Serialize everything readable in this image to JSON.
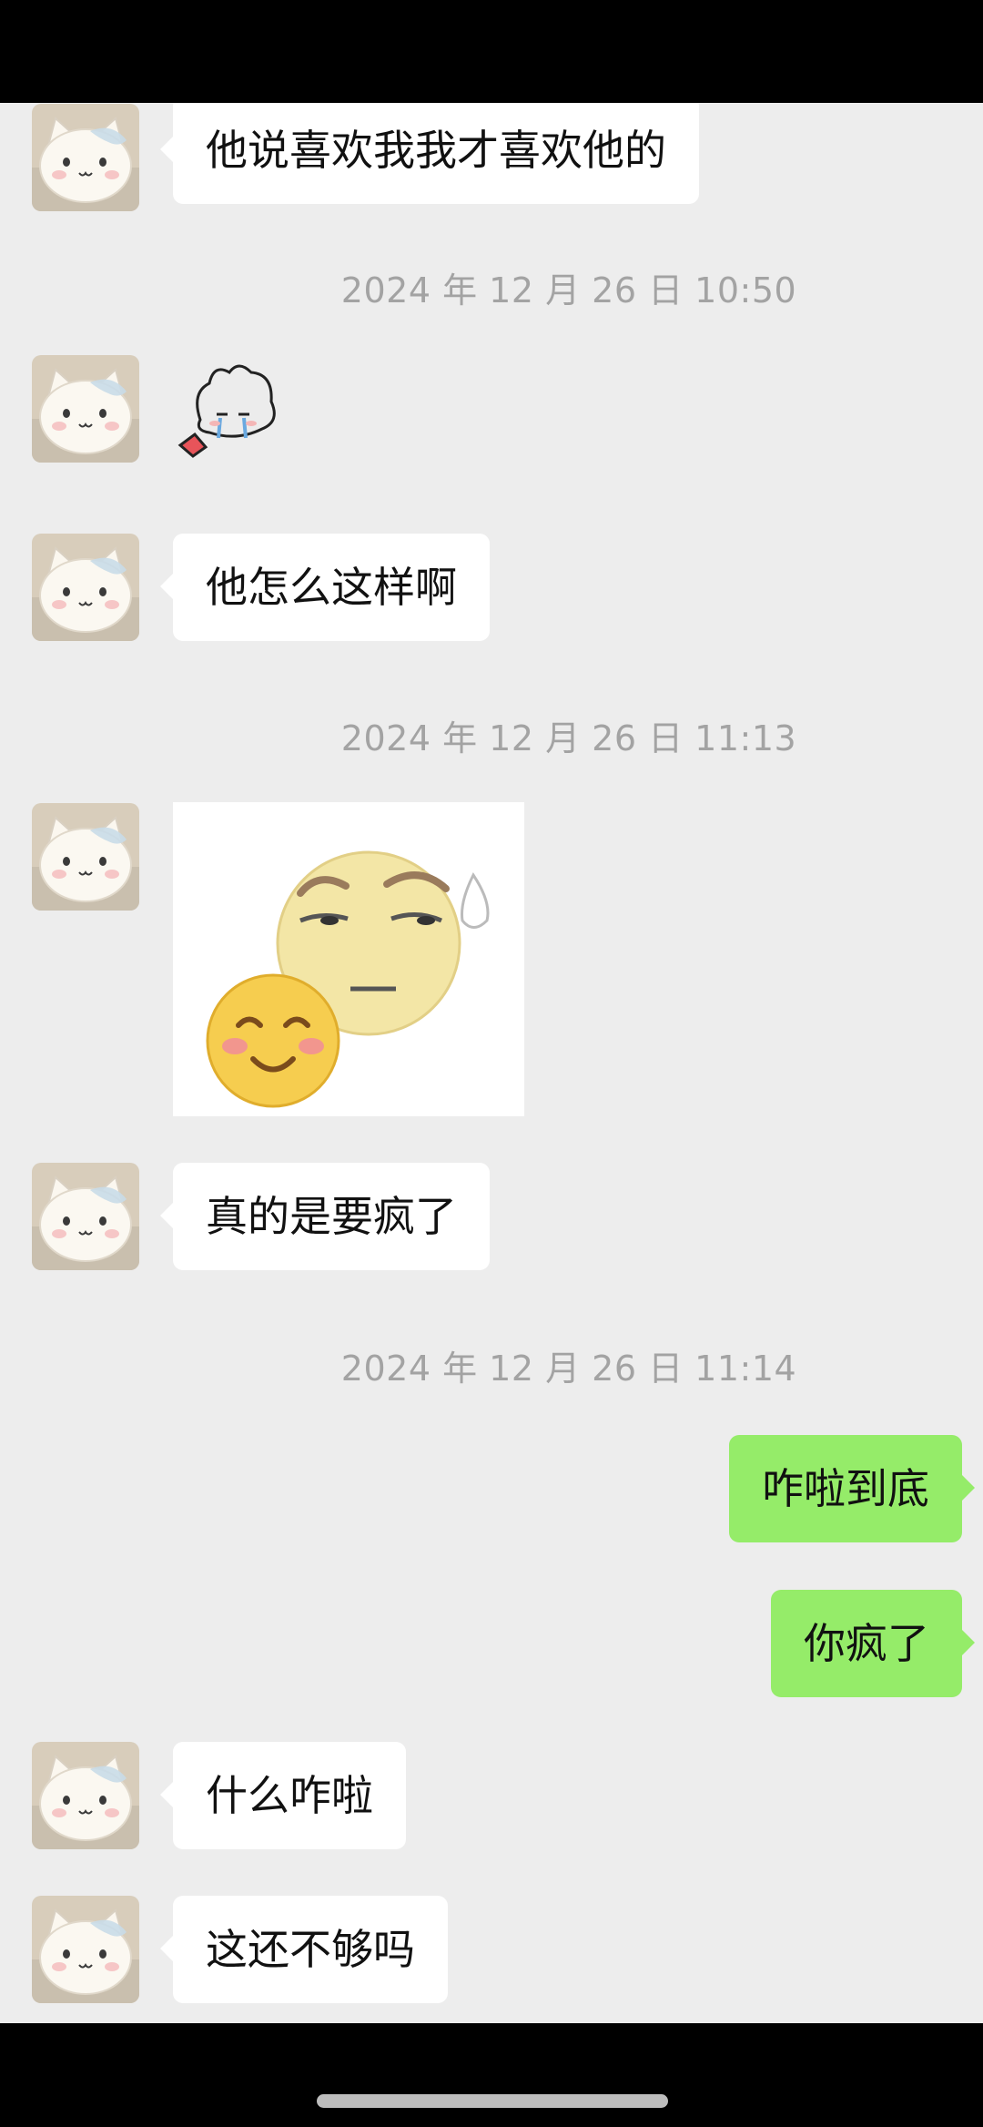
{
  "colors": {
    "chat_background": "#ededed",
    "incoming_bubble": "#ffffff",
    "outgoing_bubble": "#95ec69",
    "timestamp_text": "#a3a3a3"
  },
  "messages": [
    {
      "sender": "other",
      "type": "text",
      "text": "他说喜欢我我才喜欢他的"
    },
    {
      "type": "timestamp",
      "text": "2024 年 12 月 26 日 10:50"
    },
    {
      "sender": "other",
      "type": "sticker",
      "sticker": "crying-bunny-sticker"
    },
    {
      "sender": "other",
      "type": "text",
      "text": "他怎么这样啊"
    },
    {
      "type": "timestamp",
      "text": "2024 年 12 月 26 日 11:13"
    },
    {
      "sender": "other",
      "type": "image",
      "image": "emoji-meme-sticker"
    },
    {
      "sender": "other",
      "type": "text",
      "text": "真的是要疯了"
    },
    {
      "type": "timestamp",
      "text": "2024 年 12 月 26 日 11:14"
    },
    {
      "sender": "me",
      "type": "text",
      "text": "咋啦到底"
    },
    {
      "sender": "me",
      "type": "text",
      "text": "你疯了"
    },
    {
      "sender": "other",
      "type": "text",
      "text": "什么咋啦"
    },
    {
      "sender": "other",
      "type": "text",
      "text": "这还不够吗"
    }
  ]
}
